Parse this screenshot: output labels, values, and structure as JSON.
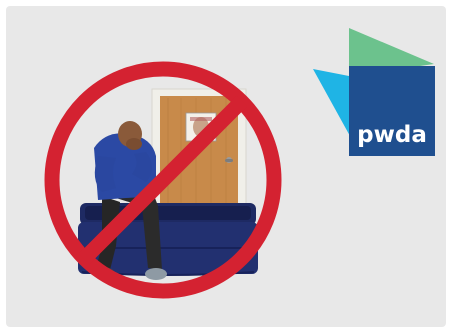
{
  "colors": {
    "background": "#e8e8e8",
    "prohibition_red": "#d42231",
    "logo_navy": "#1f4f8f",
    "logo_cyan": "#1fb4e5",
    "logo_green": "#6cc28d",
    "mattress_blue": "#1e2a63",
    "door_wood": "#c88a4a",
    "shirt_blue": "#2b49a4"
  },
  "icons": [
    "prohibition-sign-icon",
    "person-sitting-on-mattress-illustration",
    "door-illustration",
    "pwda-logo"
  ],
  "logo": {
    "text": "pwda"
  }
}
